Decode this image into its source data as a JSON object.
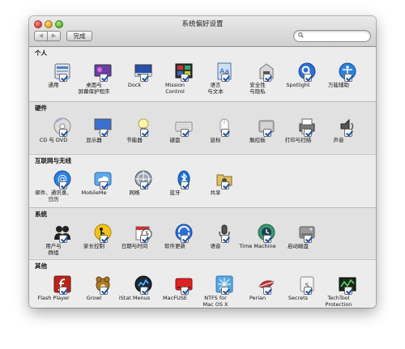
{
  "window": {
    "title": "系统偏好设置",
    "back_label": "◀",
    "forward_label": "▶",
    "done_label": "完成",
    "search_placeholder": "",
    "search_value": ""
  },
  "sections": [
    {
      "title": "个人",
      "items": [
        {
          "label": "通用",
          "icon": "general-icon"
        },
        {
          "label": "桌面与\n屏幕保护程序",
          "icon": "desktop-screensaver-icon"
        },
        {
          "label": "Dock",
          "icon": "dock-icon"
        },
        {
          "label": "Mission\nControl",
          "icon": "mission-control-icon"
        },
        {
          "label": "语言\n与文本",
          "icon": "language-text-icon"
        },
        {
          "label": "安全性\n与隐私",
          "icon": "security-privacy-icon"
        },
        {
          "label": "Spotlight",
          "icon": "spotlight-icon"
        },
        {
          "label": "万能辅助",
          "icon": "universal-access-icon"
        }
      ]
    },
    {
      "title": "硬件",
      "items": [
        {
          "label": "CD 与 DVD",
          "icon": "cd-dvd-icon"
        },
        {
          "label": "显示器",
          "icon": "displays-icon"
        },
        {
          "label": "节能器",
          "icon": "energy-saver-icon"
        },
        {
          "label": "键盘",
          "icon": "keyboard-icon"
        },
        {
          "label": "鼠标",
          "icon": "mouse-icon"
        },
        {
          "label": "触控板",
          "icon": "trackpad-icon"
        },
        {
          "label": "打印与扫描",
          "icon": "print-scan-icon"
        },
        {
          "label": "声音",
          "icon": "sound-icon"
        }
      ]
    },
    {
      "title": "互联网与无线",
      "items": [
        {
          "label": "邮件、通讯录、\n日历",
          "icon": "mail-contacts-calendars-icon"
        },
        {
          "label": "MobileMe",
          "icon": "mobileme-icon"
        },
        {
          "label": "网络",
          "icon": "network-icon"
        },
        {
          "label": "蓝牙",
          "icon": "bluetooth-icon"
        },
        {
          "label": "共享",
          "icon": "sharing-icon"
        }
      ]
    },
    {
      "title": "系统",
      "items": [
        {
          "label": "用户与\n群组",
          "icon": "users-groups-icon"
        },
        {
          "label": "家长控制",
          "icon": "parental-controls-icon"
        },
        {
          "label": "日期与时间",
          "icon": "date-time-icon"
        },
        {
          "label": "软件更新",
          "icon": "software-update-icon"
        },
        {
          "label": "语音",
          "icon": "speech-icon"
        },
        {
          "label": "Time Machine",
          "icon": "time-machine-icon"
        },
        {
          "label": "启动磁盘",
          "icon": "startup-disk-icon"
        }
      ]
    },
    {
      "title": "其他",
      "items": [
        {
          "label": "Flash Player",
          "icon": "flash-player-icon"
        },
        {
          "label": "Growl",
          "icon": "growl-icon"
        },
        {
          "label": "iStat Menus",
          "icon": "istat-menus-icon"
        },
        {
          "label": "MacFUSE",
          "icon": "macfuse-icon"
        },
        {
          "label": "NTFS for\nMac OS X",
          "icon": "ntfs-icon"
        },
        {
          "label": "Perian",
          "icon": "perian-icon"
        },
        {
          "label": "Secrets",
          "icon": "secrets-icon"
        },
        {
          "label": "TechTool\nProtection",
          "icon": "techtool-protection-icon"
        }
      ]
    }
  ]
}
